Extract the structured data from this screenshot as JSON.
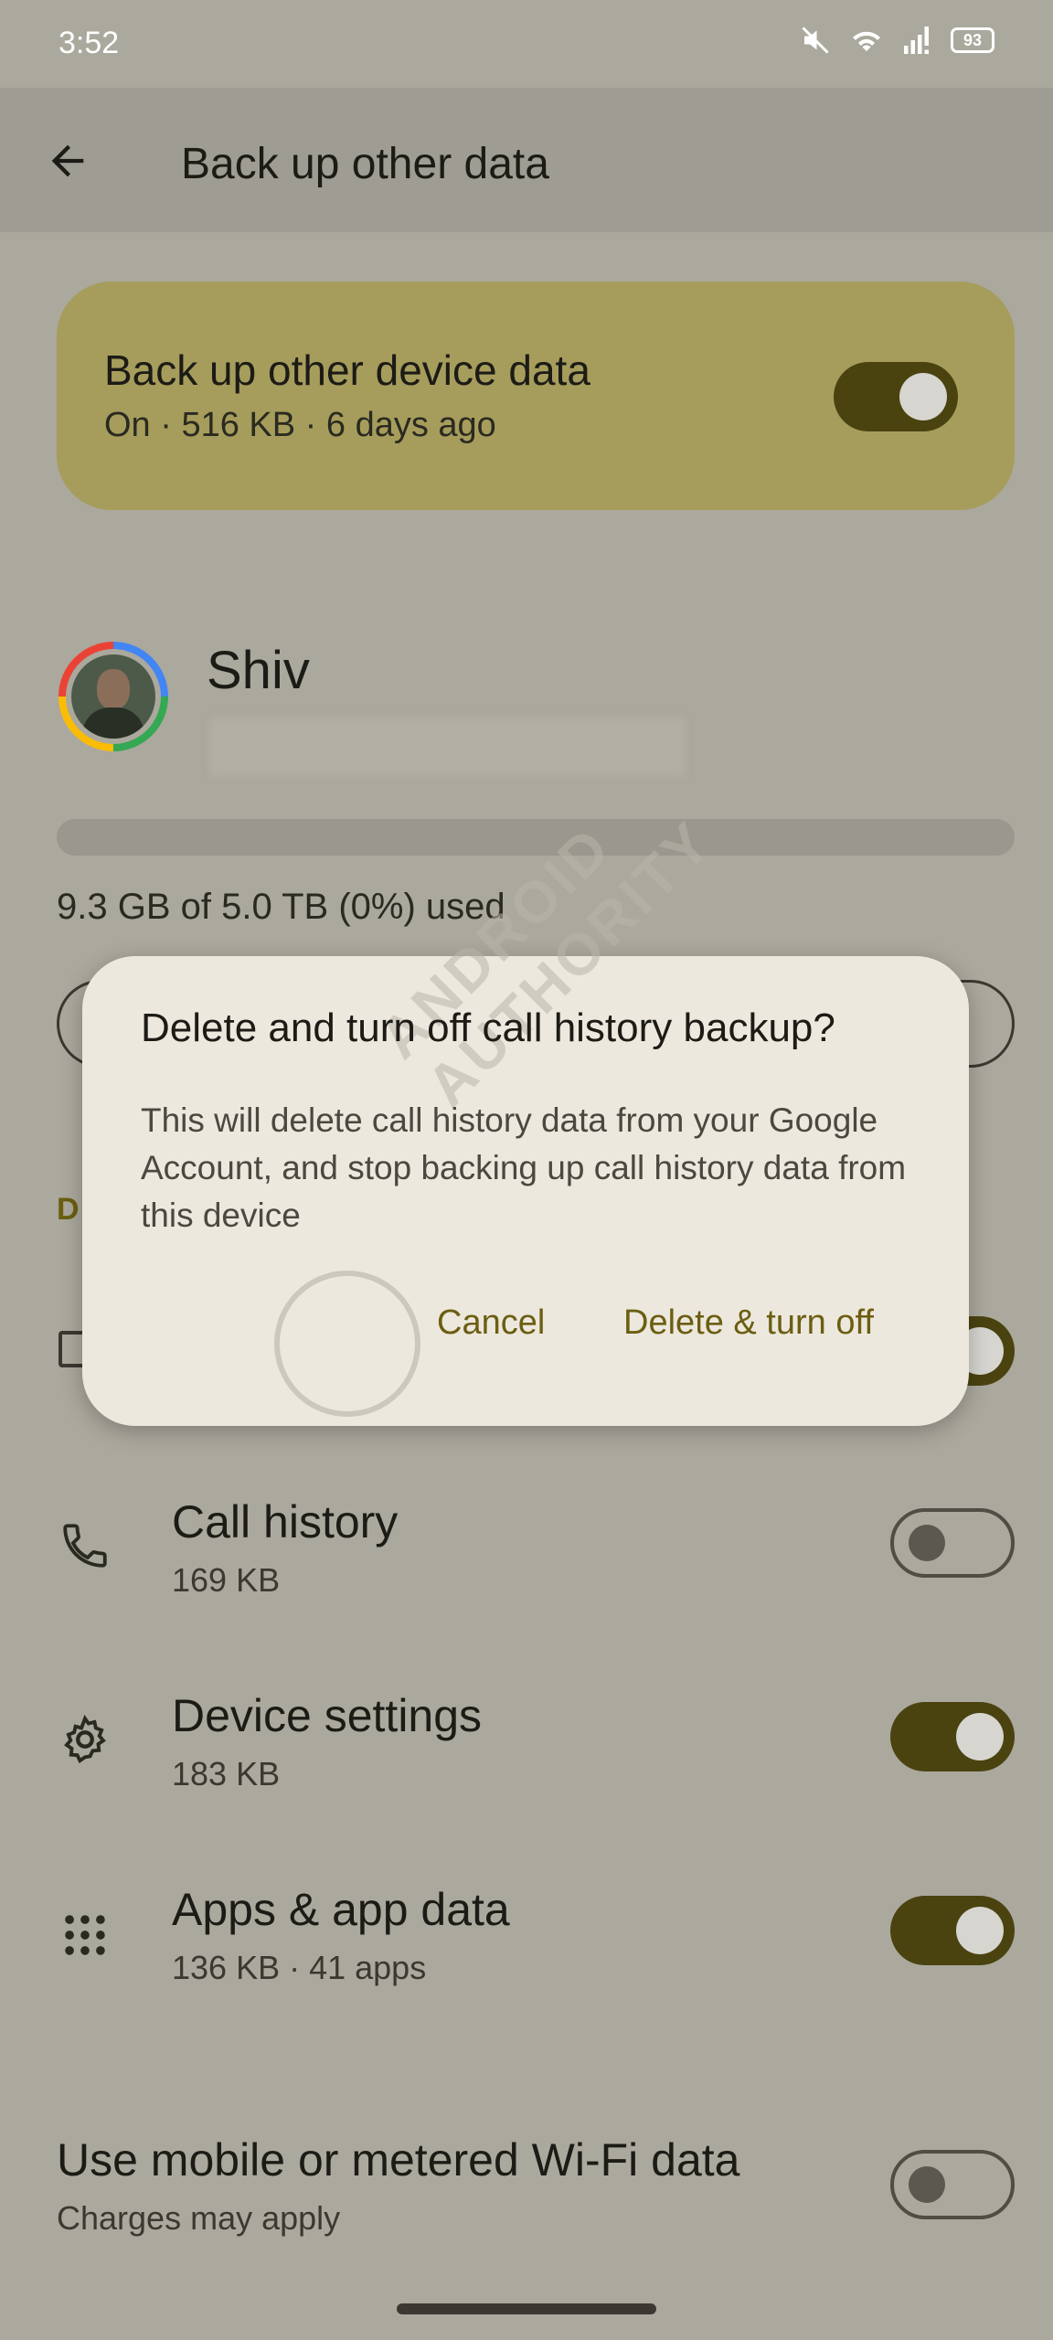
{
  "status_bar": {
    "time": "3:52",
    "battery": "93"
  },
  "app_bar": {
    "title": "Back up other data"
  },
  "backup_card": {
    "title": "Back up other device data",
    "subtitle": "On · 516 KB · 6 days ago",
    "toggle_on": true
  },
  "account": {
    "name": "Shiv"
  },
  "storage": {
    "used_text": "9.3 GB of 5.0 TB (0%) used",
    "fraction": 0.0
  },
  "section_fragment": "D",
  "items": [
    {
      "title": "Call history",
      "subtitle": "169 KB",
      "icon": "phone-icon",
      "toggle_on": false
    },
    {
      "title": "Device settings",
      "subtitle": "183 KB",
      "icon": "gear-icon",
      "toggle_on": true
    },
    {
      "title": "Apps & app data",
      "subtitle": "136 KB · 41 apps",
      "icon": "apps-grid-icon",
      "toggle_on": true
    }
  ],
  "mobile_data": {
    "title": "Use mobile or metered Wi-Fi data",
    "subtitle": "Charges may apply",
    "toggle_on": false
  },
  "dialog": {
    "title": "Delete and turn off call history backup?",
    "body": "This will delete call history data from your Google Account, and stop backing up call history data from this device",
    "cancel_label": "Cancel",
    "confirm_label": "Delete & turn off"
  },
  "watermark": "ANDROID AUTHORITY"
}
